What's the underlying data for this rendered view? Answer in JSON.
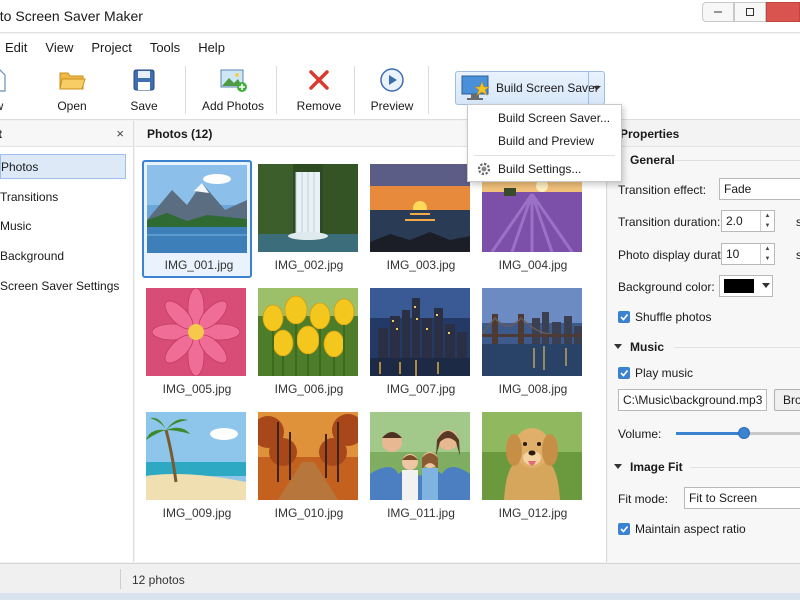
{
  "window": {
    "title": "oto Screen Saver Maker"
  },
  "menu": [
    "Edit",
    "View",
    "Project",
    "Tools",
    "Help"
  ],
  "toolbar": {
    "new_label": "w",
    "open_label": "Open",
    "save_label": "Save",
    "add_photos_label": "Add Photos",
    "remove_label": "Remove",
    "preview_label": "Preview",
    "build_label": "Build Screen Saver"
  },
  "build_menu": {
    "items": [
      "Build Screen Saver...",
      "Build and Preview",
      "Build Settings..."
    ]
  },
  "left_panel": {
    "title": "t",
    "close": "×",
    "items": [
      "Photos",
      "Transitions",
      "Music",
      "Background",
      "Screen Saver Settings"
    ]
  },
  "photos_panel": {
    "title": "Photos  (12)",
    "photos": [
      {
        "name": "IMG_001.jpg",
        "scene": "mountain-lake"
      },
      {
        "name": "IMG_002.jpg",
        "scene": "waterfall"
      },
      {
        "name": "IMG_003.jpg",
        "scene": "sunset-sea"
      },
      {
        "name": "IMG_004.jpg",
        "scene": "lavender-field"
      },
      {
        "name": "IMG_005.jpg",
        "scene": "pink-flower"
      },
      {
        "name": "IMG_006.jpg",
        "scene": "yellow-tulips"
      },
      {
        "name": "IMG_007.jpg",
        "scene": "city-night"
      },
      {
        "name": "IMG_008.jpg",
        "scene": "bridge-skyline"
      },
      {
        "name": "IMG_009.jpg",
        "scene": "tropical-beach"
      },
      {
        "name": "IMG_010.jpg",
        "scene": "autumn-forest-path"
      },
      {
        "name": "IMG_011.jpg",
        "scene": "family-portrait"
      },
      {
        "name": "IMG_012.jpg",
        "scene": "golden-retriever"
      }
    ]
  },
  "properties": {
    "title": "Properties",
    "general": {
      "title": "General",
      "transition_effect_label": "Transition effect:",
      "transition_effect_value": "Fade",
      "transition_duration_label": "Transition duration:",
      "transition_duration_value": "2.0",
      "transition_duration_unit": "s",
      "photo_display_label": "Photo display duration:",
      "photo_display_value": "10",
      "photo_display_unit": "s",
      "background_color_label": "Background color:",
      "background_color_value": "#000000",
      "shuffle_label": "Shuffle photos",
      "shuffle_checked": true
    },
    "music": {
      "title": "Music",
      "play_label": "Play music",
      "play_checked": true,
      "file_value": "C:\\Music\\background.mp3",
      "browse_label": "Bro",
      "volume_label": "Volume:",
      "volume_level": 0.55
    },
    "image_fit": {
      "title": "Image Fit",
      "fit_mode_label": "Fit mode:",
      "fit_mode_value": "Fit to Screen",
      "aspect_label": "Maintain aspect ratio",
      "aspect_checked": true
    }
  },
  "status": {
    "count": "12 photos"
  },
  "colors": {
    "accent": "#3b82d0",
    "selection_bg": "#dde9f7"
  }
}
